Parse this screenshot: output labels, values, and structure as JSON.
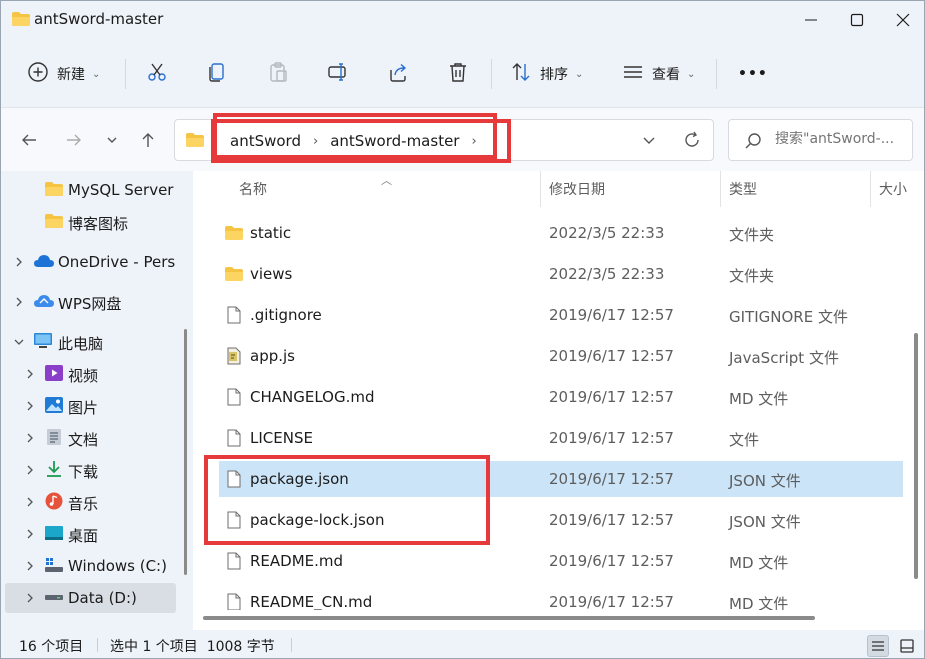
{
  "window": {
    "title": "antSword-master"
  },
  "toolbar": {
    "new_label": "新建",
    "sort_label": "排序",
    "view_label": "查看",
    "more_label": "•••"
  },
  "address": {
    "crumbs": [
      "antSword",
      "antSword-master"
    ],
    "separator": "›"
  },
  "search": {
    "placeholder": "搜索\"antSword-..."
  },
  "sidebar": {
    "items": [
      {
        "label": "MySQL Server",
        "icon": "folder-icon"
      },
      {
        "label": "博客图标",
        "icon": "folder-icon"
      },
      {
        "label": "OneDrive - Personal",
        "icon": "onedrive-icon"
      },
      {
        "label": "WPS网盘",
        "icon": "wps-cloud-icon"
      },
      {
        "label": "此电脑",
        "icon": "this-pc-icon"
      },
      {
        "label": "视频",
        "icon": "videos-icon"
      },
      {
        "label": "图片",
        "icon": "pictures-icon"
      },
      {
        "label": "文档",
        "icon": "documents-icon"
      },
      {
        "label": "下载",
        "icon": "downloads-icon"
      },
      {
        "label": "音乐",
        "icon": "music-icon"
      },
      {
        "label": "桌面",
        "icon": "desktop-icon"
      },
      {
        "label": "Windows (C:)",
        "icon": "drive-c-icon"
      },
      {
        "label": "Data (D:)",
        "icon": "drive-d-icon"
      }
    ]
  },
  "columns": {
    "name": "名称",
    "date": "修改日期",
    "type": "类型",
    "size": "大小"
  },
  "files": [
    {
      "name": "static",
      "date": "2022/3/5 22:33",
      "type": "文件夹",
      "icon": "folder-icon"
    },
    {
      "name": "views",
      "date": "2022/3/5 22:33",
      "type": "文件夹",
      "icon": "folder-icon"
    },
    {
      "name": ".gitignore",
      "date": "2019/6/17 12:57",
      "type": "GITIGNORE 文件",
      "icon": "file-icon"
    },
    {
      "name": "app.js",
      "date": "2019/6/17 12:57",
      "type": "JavaScript 文件",
      "icon": "js-file-icon"
    },
    {
      "name": "CHANGELOG.md",
      "date": "2019/6/17 12:57",
      "type": "MD 文件",
      "icon": "file-icon"
    },
    {
      "name": "LICENSE",
      "date": "2019/6/17 12:57",
      "type": "文件",
      "icon": "file-icon"
    },
    {
      "name": "package.json",
      "date": "2019/6/17 12:57",
      "type": "JSON 文件",
      "icon": "file-icon"
    },
    {
      "name": "package-lock.json",
      "date": "2019/6/17 12:57",
      "type": "JSON 文件",
      "icon": "file-icon"
    },
    {
      "name": "README.md",
      "date": "2019/6/17 12:57",
      "type": "MD 文件",
      "icon": "file-icon"
    },
    {
      "name": "README_CN.md",
      "date": "2019/6/17 12:57",
      "type": "MD 文件",
      "icon": "file-icon"
    }
  ],
  "status": {
    "count": "16 个项目",
    "selection": "选中 1 个项目  1008 字节"
  },
  "colors": {
    "highlight": "#e5393b",
    "selection": "#cce4f7",
    "folder": "#f6c443"
  }
}
